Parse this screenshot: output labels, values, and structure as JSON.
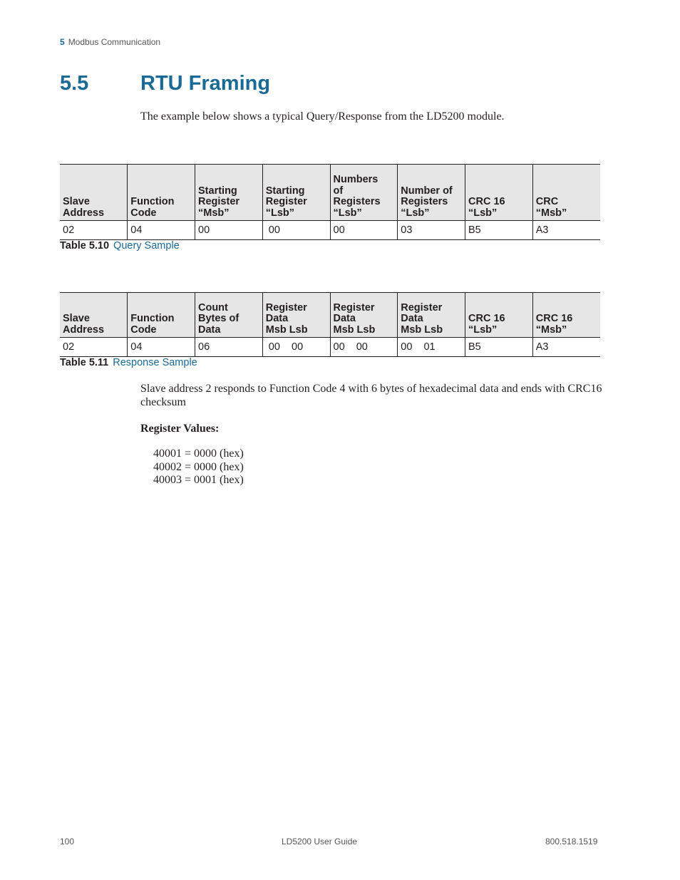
{
  "running_header": {
    "chapter_number": "5",
    "chapter_title": "Modbus Communication"
  },
  "section": {
    "number": "5.5",
    "title": "RTU Framing"
  },
  "intro_text": "The example below shows a typical Query/Response from the LD5200 module.",
  "query_table": {
    "headers": [
      "Slave\nAddress",
      "Function\nCode",
      "Starting\nRegister\n“Msb”",
      "Starting\nRegister\n“Lsb”",
      "Numbers\nof\nRegisters\n“Lsb”",
      "Number of\nRegisters\n“Lsb”",
      "CRC 16\n“Lsb”",
      "CRC\n“Msb”"
    ],
    "rows": [
      [
        "02",
        "04",
        "00",
        " 00",
        "00",
        "03",
        "B5",
        "A3"
      ]
    ],
    "caption_label": "Table 5.10",
    "caption_title": "Query Sample"
  },
  "response_table": {
    "headers": [
      "Slave\nAddress",
      "Function\nCode",
      "Count\nBytes of\nData",
      "Register\nData\nMsb Lsb",
      "Register\nData\nMsb Lsb",
      "Register\nData\nMsb Lsb",
      "CRC 16\n“Lsb”",
      "CRC 16\n“Msb”"
    ],
    "rows": [
      [
        "02",
        "04",
        "06",
        " 00    00",
        "00    00",
        "00    01",
        "B5",
        "A3"
      ]
    ],
    "caption_label": "Table 5.11",
    "caption_title": "Response Sample"
  },
  "explanation": "Slave address 2 responds to Function Code 4 with 6 bytes of hexadecimal data and ends with CRC16 checksum",
  "register_values": {
    "heading": "Register Values:",
    "lines": [
      "40001 = 0000 (hex)",
      "40002 = 0000 (hex)",
      "40003 = 0001 (hex)"
    ]
  },
  "footer": {
    "page_number": "100",
    "document_title": "LD5200 User Guide",
    "phone": "800.518.1519"
  }
}
